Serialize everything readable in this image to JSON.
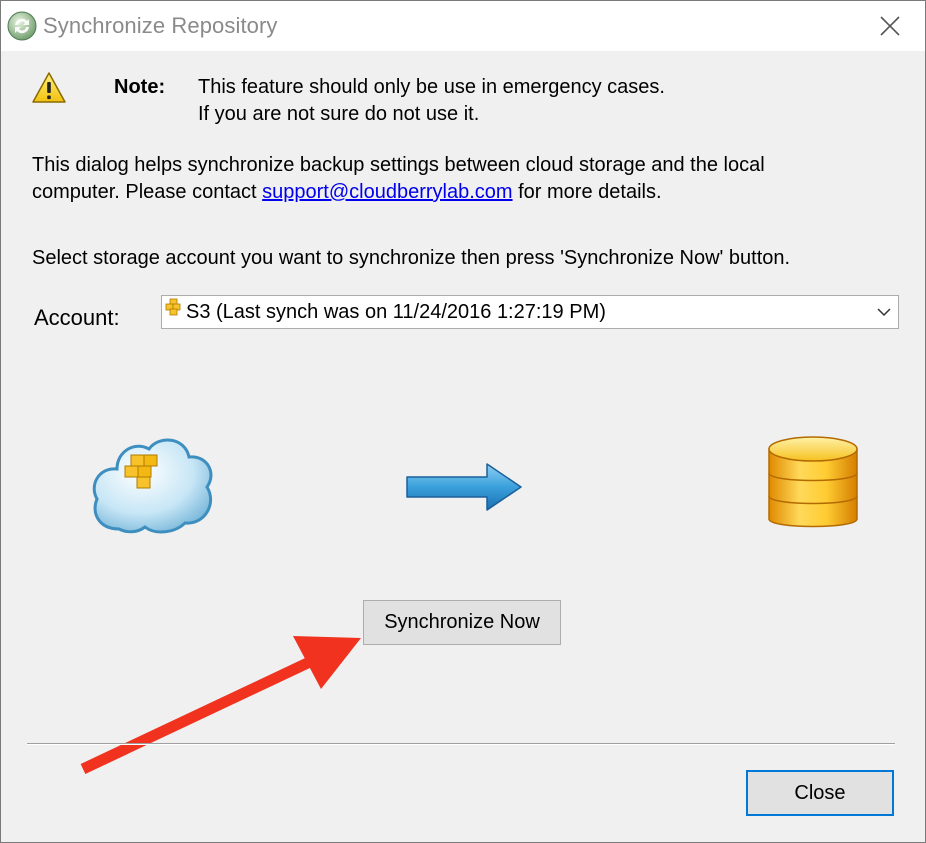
{
  "window": {
    "title": "Synchronize Repository",
    "icon": "cloudberry-sync-icon",
    "close_icon": "close-icon"
  },
  "note": {
    "label": "Note:",
    "line1": "This feature should only be use in emergency cases.",
    "line2": "If you are not sure do not use it.",
    "icon": "warning-icon"
  },
  "description": {
    "line1": "This dialog helps synchronize backup settings between cloud storage and the local",
    "line2_prefix": "computer. Please contact ",
    "link": "support@cloudberrylab.com",
    "line2_suffix": " for more details.",
    "instruction": "Select storage account you want to synchronize then press 'Synchronize Now' button."
  },
  "account": {
    "label": "Account:",
    "selected_value": "S3  (Last synch was on 11/24/2016 1:27:19 PM)",
    "icon": "s3-boxes-icon"
  },
  "illustration": {
    "source_icon": "cloud-storage-icon",
    "direction_icon": "arrow-right-icon",
    "target_icon": "database-icon"
  },
  "buttons": {
    "sync_now": "Synchronize Now",
    "close": "Close"
  },
  "colors": {
    "link": "#0000ee",
    "accent_border": "#0078d7",
    "annotation_arrow": "#f0321e",
    "dialog_background": "#f0f0f0"
  }
}
